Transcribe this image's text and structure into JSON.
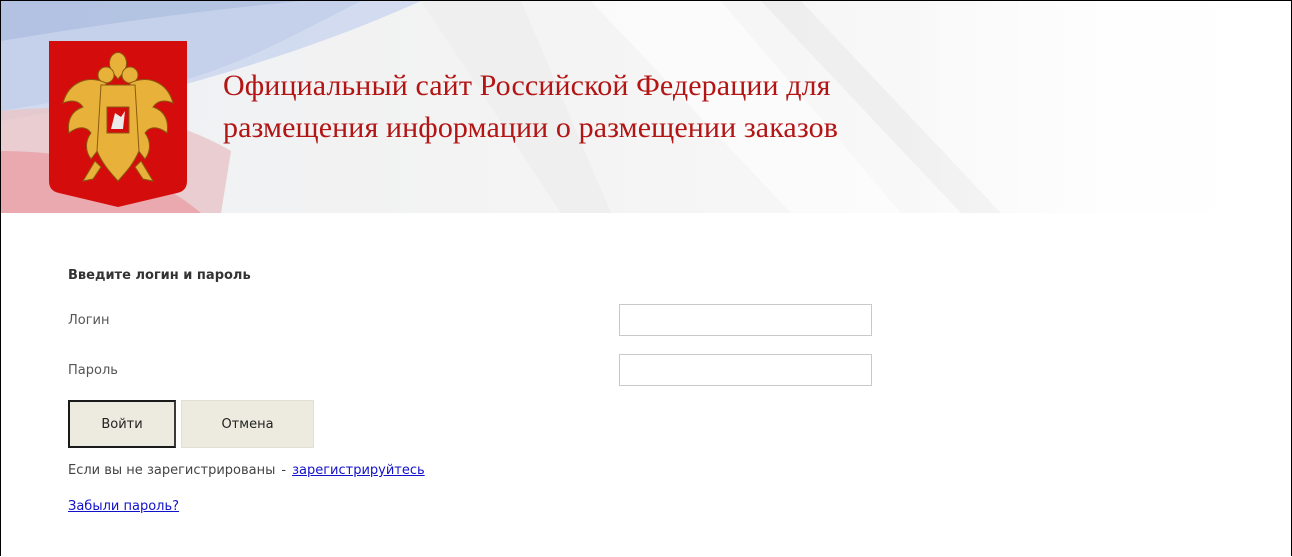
{
  "header": {
    "title": "Официальный сайт Российской Федерации для\nразмещения информации о размещении заказов",
    "emblem_icon": "russian-coat-of-arms-icon",
    "colors": {
      "title": "#b31414",
      "emblem_shield": "#d40c0c",
      "eagle": "#e8b23a"
    }
  },
  "login_form": {
    "heading": "Введите логин и пароль",
    "login_label": "Логин",
    "login_value": "",
    "password_label": "Пароль",
    "password_value": "",
    "submit_label": "Войти",
    "cancel_label": "Отмена",
    "register_prompt": "Если вы не зарегистрированы",
    "register_dash": "-",
    "register_link": "зарегистрируйтесь",
    "forgot_link": "Забыли пароль?"
  },
  "colors": {
    "link": "#1111cc",
    "button_bg": "#edebe0"
  }
}
